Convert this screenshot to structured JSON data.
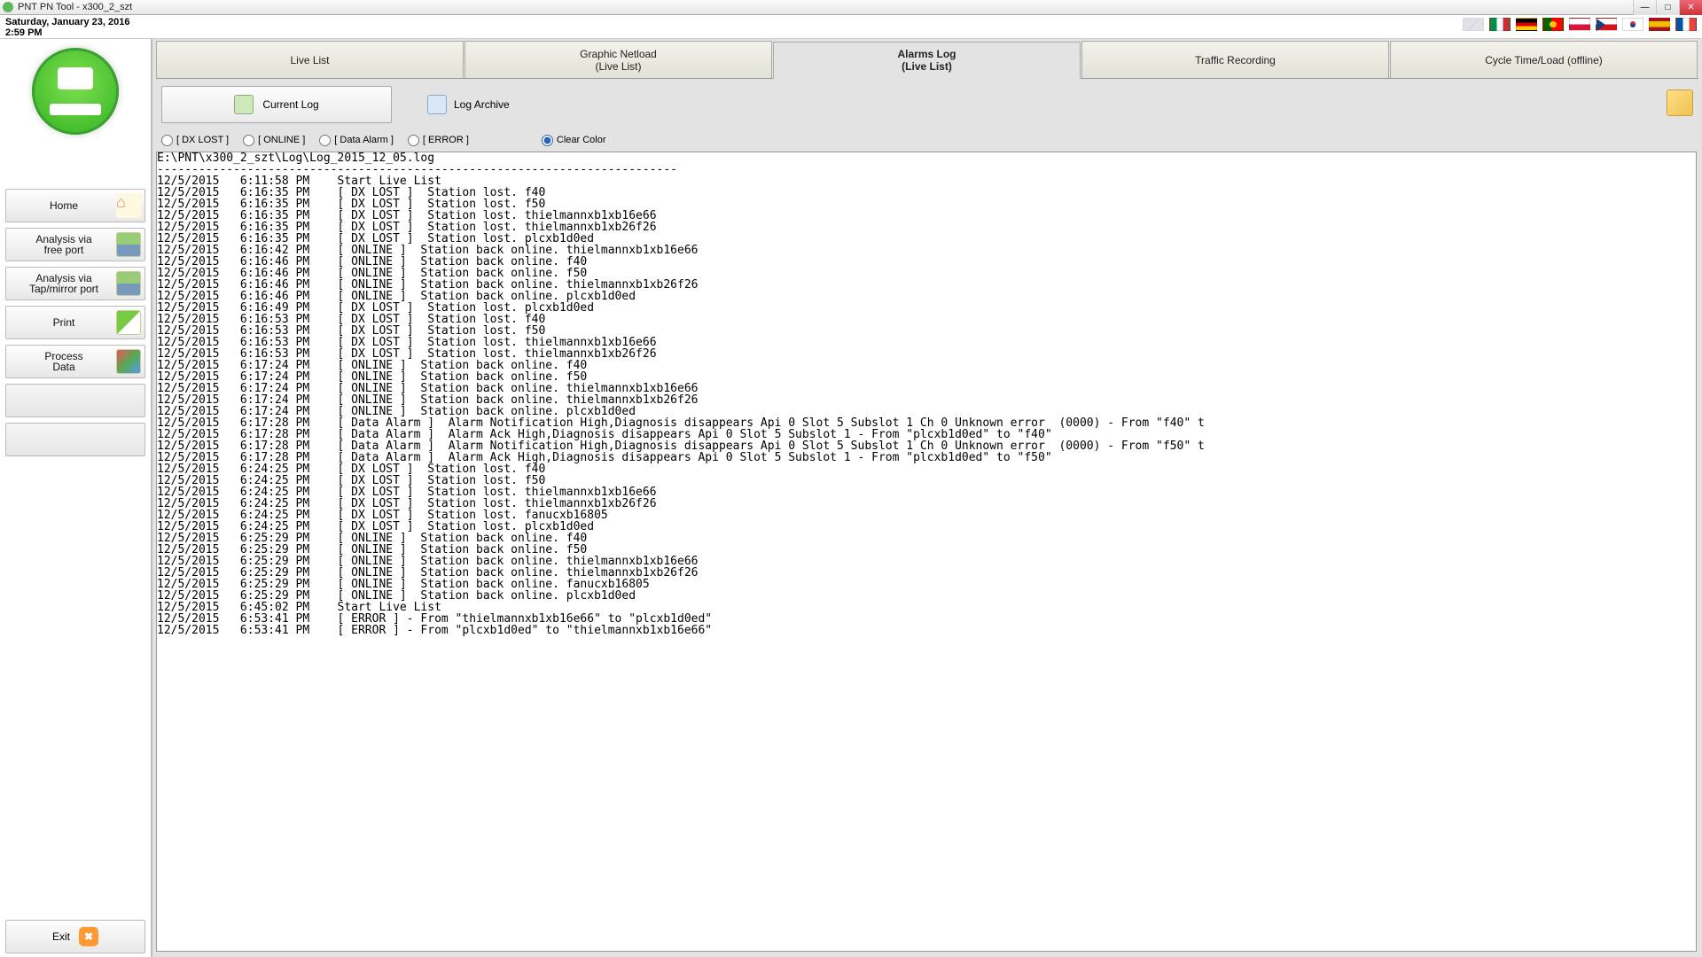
{
  "window": {
    "title": "PNT PN Tool - x300_2_szt",
    "date": "Saturday, January 23, 2016",
    "time": "2:59 PM"
  },
  "flags": [
    "uk",
    "it",
    "de",
    "pt",
    "pl",
    "cz",
    "kr",
    "es",
    "fr"
  ],
  "sidebar": {
    "home": "Home",
    "analysis_free": "Analysis via\nfree port",
    "analysis_tap": "Analysis via\nTap/mirror port",
    "print": "Print",
    "process_data": "Process\nData",
    "exit": "Exit"
  },
  "tabs": {
    "live_list": "Live List",
    "graphic_netload_l1": "Graphic Netload",
    "graphic_netload_l2": "(Live List)",
    "alarms_log_l1": "Alarms Log",
    "alarms_log_l2": "(Live List)",
    "traffic_recording": "Traffic Recording",
    "cycle_time": "Cycle Time/Load (offline)"
  },
  "toolbar": {
    "current_log": "Current Log",
    "log_archive": "Log Archive"
  },
  "filters": {
    "dx_lost": "[ DX LOST ]",
    "online": "[ ONLINE ]",
    "data_alarm": "[ Data Alarm ]",
    "error": "[ ERROR ]",
    "clear_color": "Clear Color"
  },
  "log_path": "E:\\PNT\\x300_2_szt\\Log\\Log_2015_12_05.log",
  "log_body": "---------------------------------------------------------------------------\n12/5/2015   6:11:58 PM    Start Live List\n12/5/2015   6:16:35 PM    [ DX LOST ]  Station lost. f40\n12/5/2015   6:16:35 PM    [ DX LOST ]  Station lost. f50\n12/5/2015   6:16:35 PM    [ DX LOST ]  Station lost. thielmannxb1xb16e66\n12/5/2015   6:16:35 PM    [ DX LOST ]  Station lost. thielmannxb1xb26f26\n12/5/2015   6:16:35 PM    [ DX LOST ]  Station lost. plcxb1d0ed\n12/5/2015   6:16:42 PM    [ ONLINE ]  Station back online. thielmannxb1xb16e66\n12/5/2015   6:16:46 PM    [ ONLINE ]  Station back online. f40\n12/5/2015   6:16:46 PM    [ ONLINE ]  Station back online. f50\n12/5/2015   6:16:46 PM    [ ONLINE ]  Station back online. thielmannxb1xb26f26\n12/5/2015   6:16:46 PM    [ ONLINE ]  Station back online. plcxb1d0ed\n12/5/2015   6:16:49 PM    [ DX LOST ]  Station lost. plcxb1d0ed\n12/5/2015   6:16:53 PM    [ DX LOST ]  Station lost. f40\n12/5/2015   6:16:53 PM    [ DX LOST ]  Station lost. f50\n12/5/2015   6:16:53 PM    [ DX LOST ]  Station lost. thielmannxb1xb16e66\n12/5/2015   6:16:53 PM    [ DX LOST ]  Station lost. thielmannxb1xb26f26\n12/5/2015   6:17:24 PM    [ ONLINE ]  Station back online. f40\n12/5/2015   6:17:24 PM    [ ONLINE ]  Station back online. f50\n12/5/2015   6:17:24 PM    [ ONLINE ]  Station back online. thielmannxb1xb16e66\n12/5/2015   6:17:24 PM    [ ONLINE ]  Station back online. thielmannxb1xb26f26\n12/5/2015   6:17:24 PM    [ ONLINE ]  Station back online. plcxb1d0ed\n12/5/2015   6:17:28 PM    [ Data Alarm ]  Alarm Notification High,Diagnosis disappears Api 0 Slot 5 Subslot 1 Ch 0 Unknown error  (0000) - From \"f40\" t\n12/5/2015   6:17:28 PM    [ Data Alarm ]  Alarm Ack High,Diagnosis disappears Api 0 Slot 5 Subslot 1 - From \"plcxb1d0ed\" to \"f40\"\n12/5/2015   6:17:28 PM    [ Data Alarm ]  Alarm Notification High,Diagnosis disappears Api 0 Slot 5 Subslot 1 Ch 0 Unknown error  (0000) - From \"f50\" t\n12/5/2015   6:17:28 PM    [ Data Alarm ]  Alarm Ack High,Diagnosis disappears Api 0 Slot 5 Subslot 1 - From \"plcxb1d0ed\" to \"f50\"\n12/5/2015   6:24:25 PM    [ DX LOST ]  Station lost. f40\n12/5/2015   6:24:25 PM    [ DX LOST ]  Station lost. f50\n12/5/2015   6:24:25 PM    [ DX LOST ]  Station lost. thielmannxb1xb16e66\n12/5/2015   6:24:25 PM    [ DX LOST ]  Station lost. thielmannxb1xb26f26\n12/5/2015   6:24:25 PM    [ DX LOST ]  Station lost. fanucxb16805\n12/5/2015   6:24:25 PM    [ DX LOST ]  Station lost. plcxb1d0ed\n12/5/2015   6:25:29 PM    [ ONLINE ]  Station back online. f40\n12/5/2015   6:25:29 PM    [ ONLINE ]  Station back online. f50\n12/5/2015   6:25:29 PM    [ ONLINE ]  Station back online. thielmannxb1xb16e66\n12/5/2015   6:25:29 PM    [ ONLINE ]  Station back online. thielmannxb1xb26f26\n12/5/2015   6:25:29 PM    [ ONLINE ]  Station back online. fanucxb16805\n12/5/2015   6:25:29 PM    [ ONLINE ]  Station back online. plcxb1d0ed\n12/5/2015   6:45:02 PM    Start Live List\n12/5/2015   6:53:41 PM    [ ERROR ] - From \"thielmannxb1xb16e66\" to \"plcxb1d0ed\"\n12/5/2015   6:53:41 PM    [ ERROR ] - From \"plcxb1d0ed\" to \"thielmannxb1xb16e66\""
}
